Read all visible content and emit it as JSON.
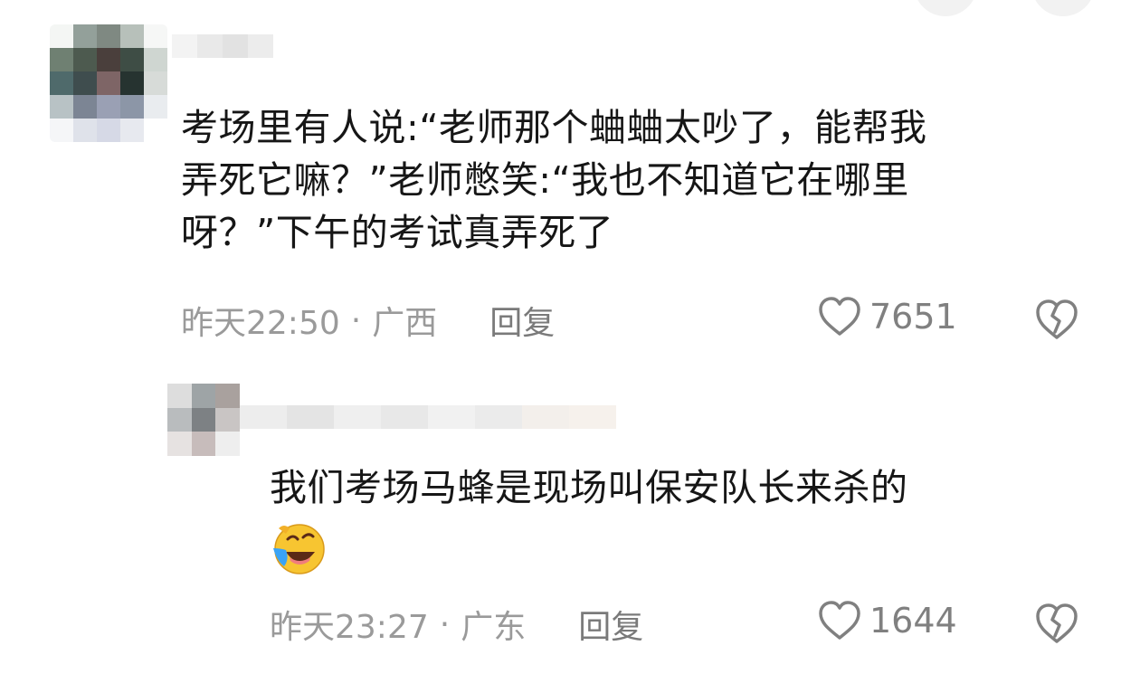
{
  "comments": [
    {
      "text": "考场里有人说:“老师那个蛐蛐太吵了，能帮我\n弄死它嘛？”老师憋笑:“我也不知道它在哪里\n呀？”下午的考试真弄死了",
      "time": "昨天22:50",
      "separator": "·",
      "location": "广西",
      "reply_label": "回复",
      "likes": "7651"
    },
    {
      "text": "我们考场马蜂是现场叫保安队长来杀的",
      "emoji": "laughing-crying-emoji",
      "time": "昨天23:27",
      "separator": "·",
      "location": "广东",
      "reply_label": "回复",
      "likes": "1644"
    }
  ],
  "icons": {
    "like": "heart-outline-icon",
    "dislike": "broken-heart-icon"
  },
  "colors": {
    "text": "#161616",
    "meta": "#9a9a9a",
    "icon": "#808080"
  }
}
